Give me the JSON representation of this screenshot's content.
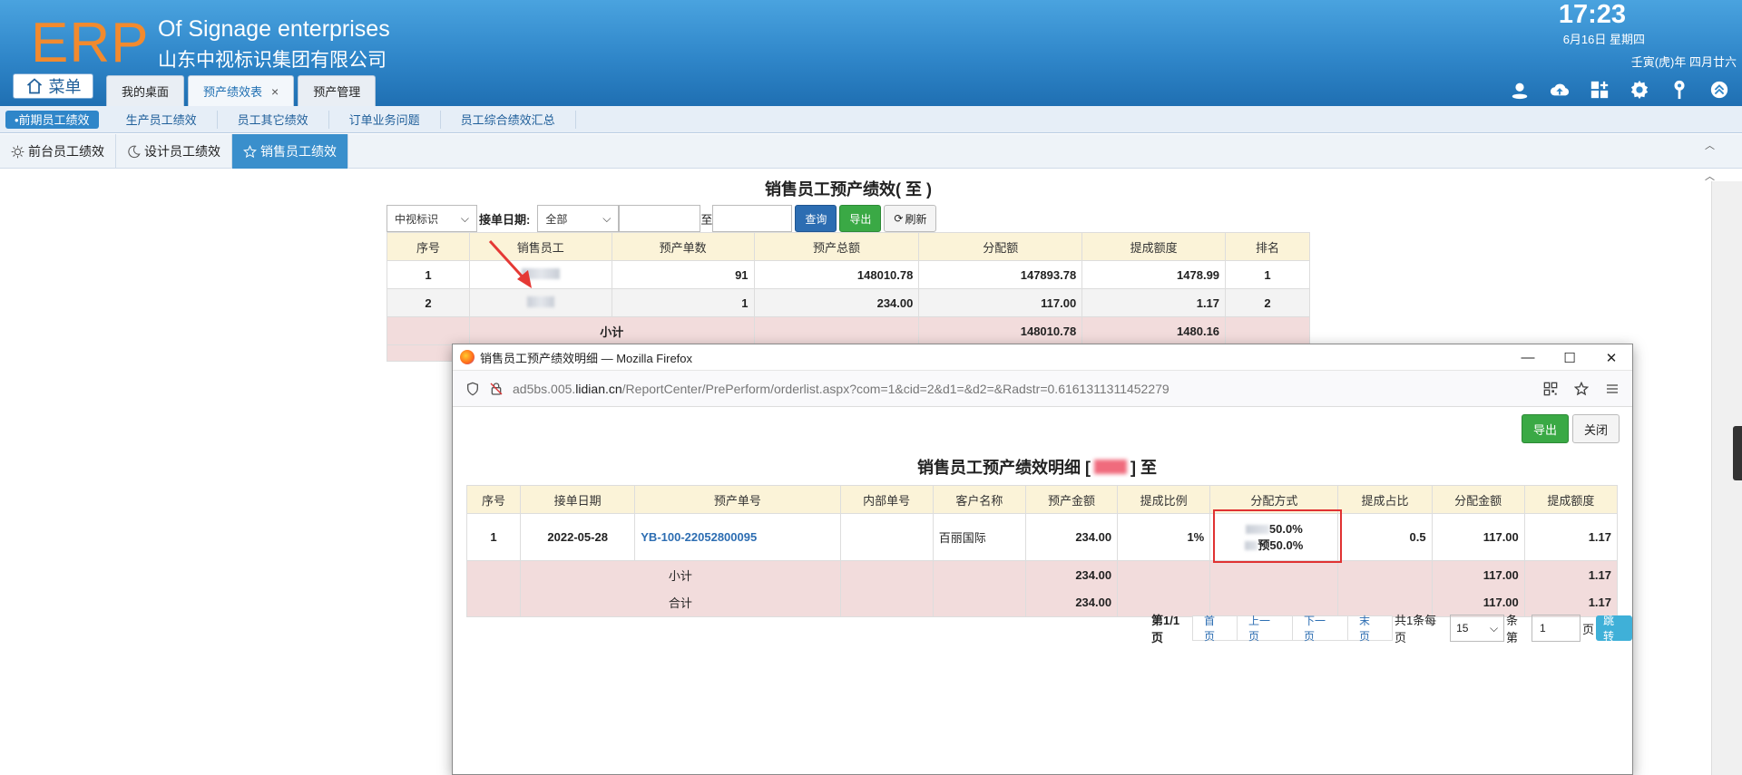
{
  "header": {
    "logo": "ERP",
    "company_en": "Of Signage enterprises",
    "company_cn": "山东中视标识集团有限公司",
    "time": "17:23",
    "date": "6月16日 星期四",
    "lunar": "壬寅(虎)年 四月廿六",
    "menu_label": "菜单",
    "tabs": [
      {
        "label": "我的桌面"
      },
      {
        "label": "预产绩效表",
        "close": "×"
      },
      {
        "label": "预产管理"
      }
    ]
  },
  "subnav": {
    "items": [
      "•前期员工绩效",
      "生产员工绩效",
      "员工其它绩效",
      "订单业务问题",
      "员工综合绩效汇总"
    ]
  },
  "tabs2": {
    "items": [
      "前台员工绩效",
      "设计员工绩效",
      "销售员工绩效"
    ]
  },
  "report": {
    "title": "销售员工预产绩效( 至 )",
    "company_select": "中视标识",
    "date_label": "接单日期:",
    "range_select": "全部",
    "to_label": "至",
    "btn_query": "查询",
    "btn_export": "导出",
    "btn_refresh": "刷新",
    "columns": [
      "序号",
      "销售员工",
      "预产单数",
      "预产总额",
      "分配额",
      "提成额度",
      "排名"
    ],
    "rows": [
      {
        "no": "1",
        "count": "91",
        "total": "148010.78",
        "alloc": "147893.78",
        "comm": "1478.99",
        "rank": "1"
      },
      {
        "no": "2",
        "count": "1",
        "total": "234.00",
        "alloc": "117.00",
        "comm": "1.17",
        "rank": "2"
      }
    ],
    "subtotal": {
      "label": "小计",
      "alloc": "148010.78",
      "comm": "1480.16"
    }
  },
  "popup": {
    "window_title": "销售员工预产绩效明细 — Mozilla Firefox",
    "url_prefix": "ad5bs.005.",
    "url_domain": "lidian.cn",
    "url_path": "/ReportCenter/PrePerform/orderlist.aspx?com=1&cid=2&d1=&d2=&Radstr=0.6161311311452279",
    "btn_export": "导出",
    "btn_close": "关闭",
    "title_left": "销售员工预产绩效明细 [",
    "title_right": "] 至",
    "columns": [
      "序号",
      "接单日期",
      "预产单号",
      "内部单号",
      "客户名称",
      "预产金额",
      "提成比例",
      "分配方式",
      "提成占比",
      "分配金额",
      "提成额度"
    ],
    "row": {
      "no": "1",
      "date": "2022-05-28",
      "order": "YB-100-22052800095",
      "inner": "",
      "customer": "百丽国际",
      "amount": "234.00",
      "ratio": "1%",
      "alloc1": "50.0%",
      "alloc2_prefix": "预",
      "alloc2": "50.0%",
      "share": "0.5",
      "alloc_amount": "117.00",
      "comm": "1.17"
    },
    "subtotal": {
      "label": "小计",
      "amount": "234.00",
      "alloc_amount": "117.00",
      "comm": "1.17"
    },
    "total": {
      "label": "合计",
      "amount": "234.00",
      "alloc_amount": "117.00",
      "comm": "1.17"
    },
    "pager": {
      "page_info": "第1/1页",
      "first": "首页",
      "prev": "上一页",
      "next": "下一页",
      "last": "末页",
      "records": "共1条每页",
      "page_size": "15",
      "size_suffix": "条第",
      "page_input": "1",
      "page_suffix": "页",
      "jump": "跳转"
    }
  }
}
